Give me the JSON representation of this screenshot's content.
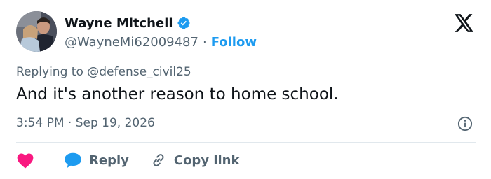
{
  "author": {
    "display_name": "Wayne Mitchell",
    "handle": "@WayneMi62009487",
    "separator": "·",
    "follow_label": "Follow",
    "verified_icon": "verified-badge-icon",
    "avatar_icon": "avatar-photo"
  },
  "brand": {
    "logo_icon": "x-logo-icon"
  },
  "tweet": {
    "replying_prefix": "Replying to ",
    "replying_to": "@defense_civil25",
    "text": "And it's another reason to home school.",
    "timestamp": "3:54 PM · Sep 19, 2026"
  },
  "actions": {
    "like_icon": "heart-icon",
    "reply_label": "Reply",
    "reply_icon": "speech-bubble-icon",
    "copy_label": "Copy link",
    "copy_icon": "link-icon",
    "info_icon": "info-icon"
  },
  "colors": {
    "accent": "#1d9bf0",
    "like": "#f91880",
    "text_primary": "#0f1419",
    "text_secondary": "#536471",
    "divider": "#e1e8ed"
  }
}
